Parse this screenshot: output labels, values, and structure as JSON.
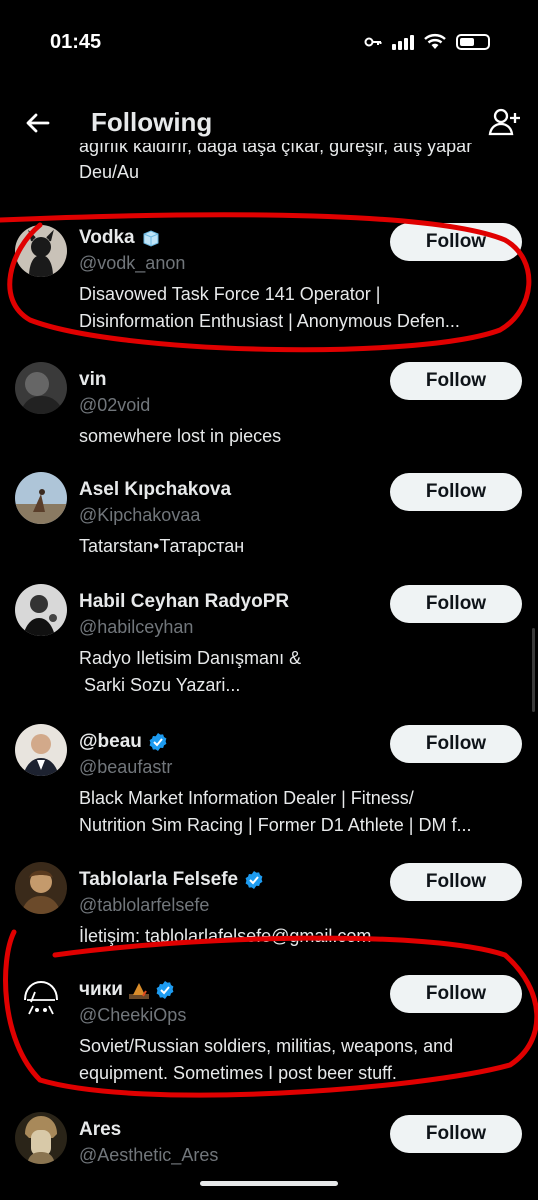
{
  "status_bar": {
    "time": "01:45"
  },
  "header": {
    "title": "Following"
  },
  "partial_bio": {
    "line1": "ağırlık kaldırır, dağa taşa çıkar, güreşir, atış yapar",
    "line2": "Deu/Au"
  },
  "users": [
    {
      "name": "Vodka",
      "name_emoji": "ice-cube",
      "handle": "@vodk_anon",
      "bio": [
        "Disavowed Task Force 141 Operator |",
        "Disinformation Enthusiast | Anonymous Defen..."
      ],
      "follow": "Follow",
      "verified": false
    },
    {
      "name": "vin",
      "handle": "@02void",
      "bio": [
        "somewhere lost in pieces"
      ],
      "follow": "Follow",
      "verified": false
    },
    {
      "name": "Asel Kıpchakova",
      "handle": "@Kipchakovaa",
      "bio": [
        "Tatarstan•Татарстан"
      ],
      "follow": "Follow",
      "verified": false
    },
    {
      "name": "Habil Ceyhan RadyoPR",
      "handle": "@habilceyhan",
      "bio": [
        "Radyo Iletisim Danışmanı &",
        " Sarki Sozu Yazari..."
      ],
      "follow": "Follow",
      "verified": false
    },
    {
      "name": "@beau",
      "handle": "@beaufastr",
      "bio": [
        "Black Market Information Dealer | Fitness/",
        "Nutrition Sim Racing | Former D1 Athlete | DM f..."
      ],
      "follow": "Follow",
      "verified": true
    },
    {
      "name": "Tablolarla Felsefe",
      "handle": "@tablolarfelsefe",
      "bio": [
        "İletişim: tablolarlafelsefe@gmail.com"
      ],
      "follow": "Follow",
      "verified": true
    },
    {
      "name": "чики",
      "name_emoji": "camp-emoji",
      "handle": "@CheekiOps",
      "bio": [
        "Soviet/Russian soldiers, militias, weapons, and",
        "equipment. Sometimes I post beer stuff."
      ],
      "follow": "Follow",
      "verified": true
    },
    {
      "name": "Ares",
      "handle": "@Aesthetic_Ares",
      "bio": [],
      "follow": "Follow",
      "verified": false
    }
  ],
  "colors": {
    "background": "#000000",
    "text": "#e7e9ea",
    "muted": "#71767b",
    "button_bg": "#eff3f4",
    "verified": "#1d9bf0",
    "annotation": "#e00000"
  }
}
